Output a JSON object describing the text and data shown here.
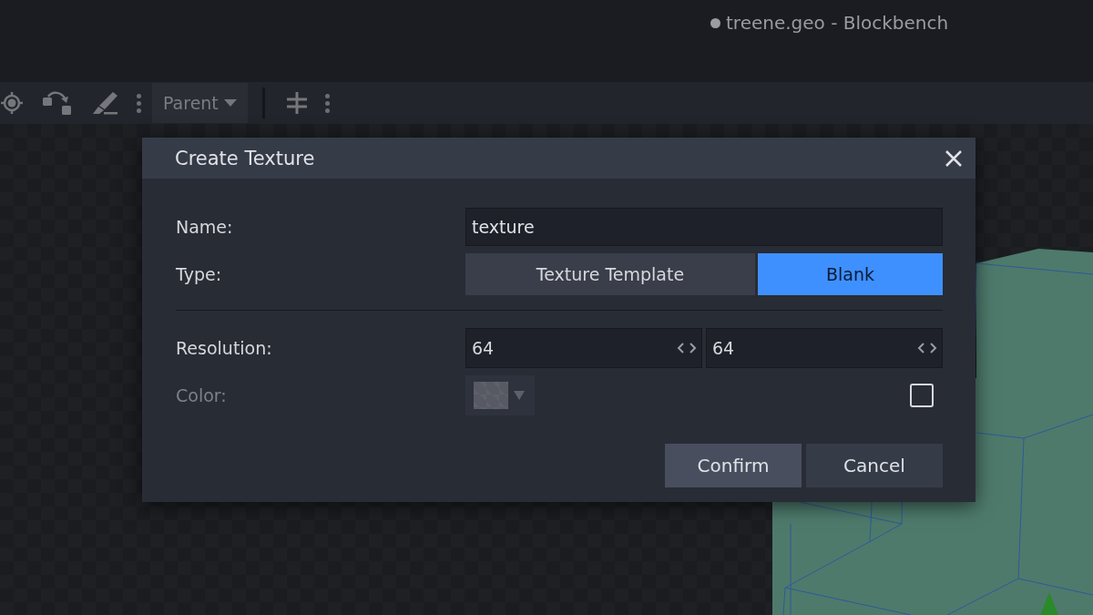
{
  "window": {
    "title": "treene.geo - Blockbench",
    "unsaved": true
  },
  "toolbar": {
    "items": [
      {
        "kind": "target"
      },
      {
        "kind": "rotate"
      },
      {
        "kind": "brush"
      },
      {
        "kind": "more"
      },
      {
        "kind": "dropdown",
        "label": "Parent"
      },
      {
        "kind": "separator"
      },
      {
        "kind": "pivot"
      },
      {
        "kind": "more"
      }
    ]
  },
  "dialog": {
    "title": "Create Texture",
    "name": {
      "label": "Name:",
      "value": "texture"
    },
    "type": {
      "label": "Type:",
      "options": [
        {
          "label": "Texture Template",
          "selected": false
        },
        {
          "label": "Blank",
          "selected": true
        }
      ]
    },
    "resolution": {
      "label": "Resolution:",
      "values": [
        "64",
        "64"
      ]
    },
    "color": {
      "label": "Color:",
      "disabled": true,
      "checked": false
    },
    "buttons": [
      {
        "label": "Confirm",
        "primary": true
      },
      {
        "label": "Cancel",
        "primary": false
      }
    ]
  }
}
